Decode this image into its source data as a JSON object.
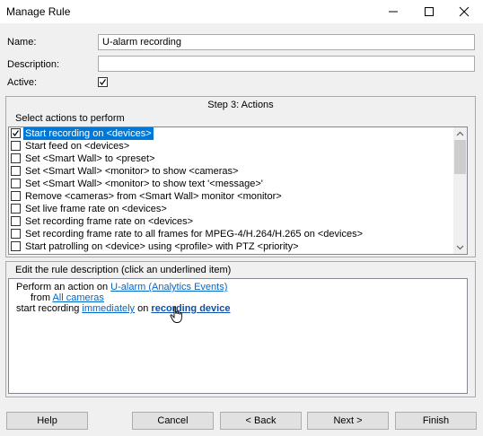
{
  "window": {
    "title": "Manage Rule",
    "minimize_icon": "minimize-icon",
    "maximize_icon": "maximize-icon",
    "close_icon": "close-icon"
  },
  "form": {
    "name_label": "Name:",
    "name_value": "U-alarm recording",
    "description_label": "Description:",
    "description_value": "",
    "active_label": "Active:",
    "active_checked": true
  },
  "actions_section": {
    "step_title": "Step 3: Actions",
    "prompt": "Select actions to perform",
    "items": [
      {
        "label": "Start recording on <devices>",
        "checked": true,
        "selected": true
      },
      {
        "label": "Start feed on <devices>",
        "checked": false,
        "selected": false
      },
      {
        "label": "Set <Smart Wall> to <preset>",
        "checked": false,
        "selected": false
      },
      {
        "label": "Set <Smart Wall> <monitor> to show <cameras>",
        "checked": false,
        "selected": false
      },
      {
        "label": "Set <Smart Wall> <monitor> to show text '<message>'",
        "checked": false,
        "selected": false
      },
      {
        "label": "Remove <cameras> from <Smart Wall> monitor <monitor>",
        "checked": false,
        "selected": false
      },
      {
        "label": "Set live frame rate on <devices>",
        "checked": false,
        "selected": false
      },
      {
        "label": "Set recording frame rate on <devices>",
        "checked": false,
        "selected": false
      },
      {
        "label": "Set recording frame rate to all frames for MPEG-4/H.264/H.265 on <devices>",
        "checked": false,
        "selected": false
      },
      {
        "label": "Start patrolling on <device> using <profile> with PTZ <priority>",
        "checked": false,
        "selected": false
      }
    ]
  },
  "description_section": {
    "prompt": "Edit the rule description (click an underlined item)",
    "line1_prefix": "Perform an action on ",
    "line1_link": "U-alarm (Analytics Events)",
    "line2_prefix": "from ",
    "line2_link": "All cameras",
    "line3_prefix": "start recording ",
    "line3_link": "immediately",
    "line3_middle": " on ",
    "line3_link2": "recording device"
  },
  "buttons": {
    "help": "Help",
    "cancel": "Cancel",
    "back": "< Back",
    "next": "Next >",
    "finish": "Finish"
  },
  "colors": {
    "selection": "#0078d7",
    "link": "#0066cc"
  }
}
